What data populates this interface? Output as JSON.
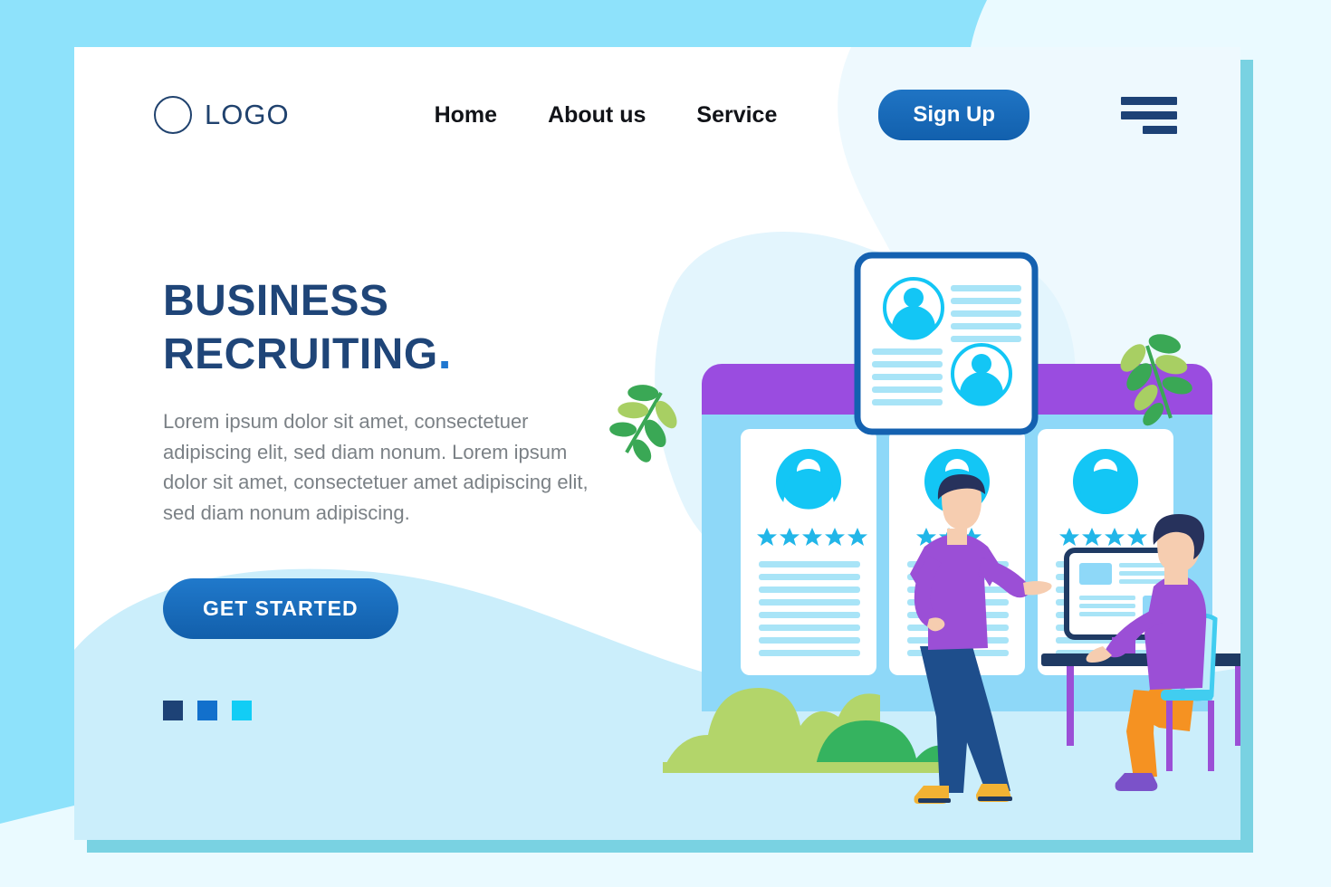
{
  "background": {
    "page_color": "#8ee2fb",
    "blob_color": "#eafaff",
    "card_color": "#ffffff",
    "card_shadow_color": "#79d2e2",
    "wave_color": "#cbeefb"
  },
  "header": {
    "logo": {
      "icon": "circle-outline-icon",
      "text": "LOGO",
      "color": "#20426e"
    },
    "nav_links": [
      {
        "label": "Home"
      },
      {
        "label": "About us"
      },
      {
        "label": "Service"
      }
    ],
    "signup_label": "Sign Up",
    "signup_color": "#1260ad",
    "menu_icon": "hamburger-menu-icon"
  },
  "hero": {
    "title_line1": "BUSINESS",
    "title_line2": "RECRUITING",
    "title_dot": ".",
    "title_color": "#1f4578",
    "paragraph": "Lorem ipsum dolor sit amet, consectetuer adipiscing elit, sed diam nonum. Lorem ipsum dolor sit amet, consectetuer amet adipiscing elit, sed diam nonum adipiscing.",
    "cta_label": "GET STARTED",
    "cta_color": "#125fab",
    "pagination_dots": [
      {
        "color": "#1d4276"
      },
      {
        "color": "#1270cc"
      },
      {
        "color": "#12cdf5"
      }
    ]
  },
  "illustration": {
    "name": "business-recruiting-illustration",
    "panel": {
      "header_bar_color": "#9a4ce0",
      "body_color": "#8ed8f8"
    },
    "profile_cards": [
      {
        "stars": 5,
        "lines": 8
      },
      {
        "stars": 3,
        "lines": 8
      },
      {
        "stars": 4,
        "lines": 8
      }
    ],
    "star_color": "#22b6e8",
    "avatar_color": "#13c6f5",
    "floating_resume_card": {
      "border_color": "#1461b0",
      "rows": [
        {
          "avatar_side": "left",
          "lines": 5
        },
        {
          "avatar_side": "right",
          "lines": 5
        }
      ]
    },
    "standing_person": {
      "shirt_color": "#9b4fd6",
      "pants_color": "#1e4e8c",
      "shoes_color": "#f2b233",
      "hair_color": "#27325c",
      "skin_color": "#f6cdb0"
    },
    "seated_person": {
      "shirt_color": "#9b4fd6",
      "pants_color": "#f59222",
      "shoes_color": "#7b52c9",
      "hair_color": "#27325c",
      "skin_color": "#f6cdb0",
      "chair_color": "#41cdf0",
      "desk_color": "#1f3a63",
      "monitor_border_color": "#1f3a63"
    },
    "plants": [
      {
        "position": "left",
        "leaf_colors": [
          "#3aa855",
          "#a8cf63"
        ]
      },
      {
        "position": "right",
        "leaf_colors": [
          "#3aa855",
          "#a8cf63"
        ]
      }
    ],
    "bushes": {
      "light_color": "#b3d56a",
      "dark_color": "#35b35f"
    }
  }
}
